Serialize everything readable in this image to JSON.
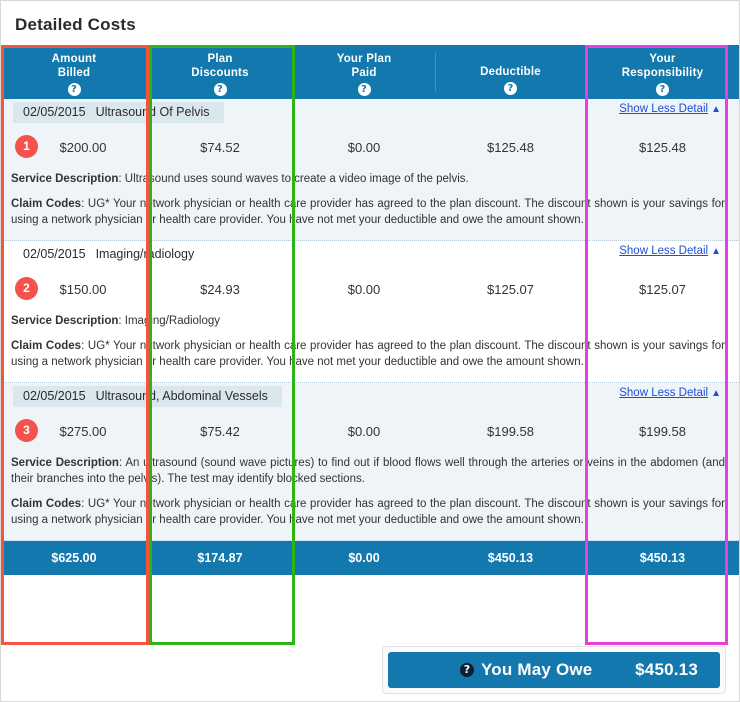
{
  "page": {
    "title": "Detailed Costs"
  },
  "columns": [
    {
      "label_line1": "Amount",
      "label_line2": "Billed",
      "help_icon": "question-mark-icon"
    },
    {
      "label_line1": "Plan",
      "label_line2": "Discounts",
      "help_icon": "question-mark-icon"
    },
    {
      "label_line1": "Your Plan",
      "label_line2": "Paid",
      "help_icon": "question-mark-icon"
    },
    {
      "label_line1": "Deductible",
      "label_line2": "",
      "help_icon": "question-mark-icon"
    },
    {
      "label_line1": "Your",
      "label_line2": "Responsibility",
      "help_icon": "question-mark-icon"
    }
  ],
  "claims": [
    {
      "badge": "1",
      "date": "02/05/2015",
      "service": "Ultrasound Of Pelvis",
      "toggle_label": "Show Less Detail",
      "toggle_caret": "▲",
      "amount_billed": "$200.00",
      "plan_discounts": "$74.52",
      "your_plan_paid": "$0.00",
      "deductible": "$125.48",
      "your_responsibility": "$125.48",
      "service_description_label": "Service Description",
      "service_description": "Ultrasound uses sound waves to create a video image of the pelvis.",
      "claim_codes_label": "Claim Codes",
      "claim_codes": "UG* Your network physician or health care provider has agreed to the plan discount. The discount shown is your savings for using a network physician or health care provider. You have not met your deductible and owe the amount shown."
    },
    {
      "badge": "2",
      "date": "02/05/2015",
      "service": "Imaging/radiology",
      "toggle_label": "Show Less Detail",
      "toggle_caret": "▲",
      "amount_billed": "$150.00",
      "plan_discounts": "$24.93",
      "your_plan_paid": "$0.00",
      "deductible": "$125.07",
      "your_responsibility": "$125.07",
      "service_description_label": "Service Description",
      "service_description": "Imaging/Radiology",
      "claim_codes_label": "Claim Codes",
      "claim_codes": "UG* Your network physician or health care provider has agreed to the plan discount. The discount shown is your savings for using a network physician or health care provider. You have not met your deductible and owe the amount shown."
    },
    {
      "badge": "3",
      "date": "02/05/2015",
      "service": "Ultrasound, Abdominal Vessels",
      "toggle_label": "Show Less Detail",
      "toggle_caret": "▲",
      "amount_billed": "$275.00",
      "plan_discounts": "$75.42",
      "your_plan_paid": "$0.00",
      "deductible": "$199.58",
      "your_responsibility": "$199.58",
      "service_description_label": "Service Description",
      "service_description": "An ultrasound (sound wave pictures) to find out if blood flows well through the arteries or veins in the abdomen (and their branches into the pelvis). The test may identify blocked sections.",
      "claim_codes_label": "Claim Codes",
      "claim_codes": "UG* Your network physician or health care provider has agreed to the plan discount. The discount shown is your savings for using a network physician or health care provider. You have not met your deductible and owe the amount shown."
    }
  ],
  "totals": {
    "amount_billed": "$625.00",
    "plan_discounts": "$174.87",
    "your_plan_paid": "$0.00",
    "deductible": "$450.13",
    "your_responsibility": "$450.13"
  },
  "you_may_owe": {
    "help_icon": "question-mark-icon",
    "label": "You May Owe",
    "amount": "$450.13"
  },
  "annotations": [
    {
      "target": "Amount Billed",
      "color": "#f4553f"
    },
    {
      "target": "Plan Discounts",
      "color": "#2cb514"
    },
    {
      "target": "Your Responsibility",
      "color": "#e83fe0"
    }
  ],
  "colors": {
    "header_blue": "#1278ae",
    "badge_red": "#f4524c",
    "row_alt": "#eff4f8",
    "pill": "#dbe7ee",
    "link_blue": "#1c4fd8"
  }
}
